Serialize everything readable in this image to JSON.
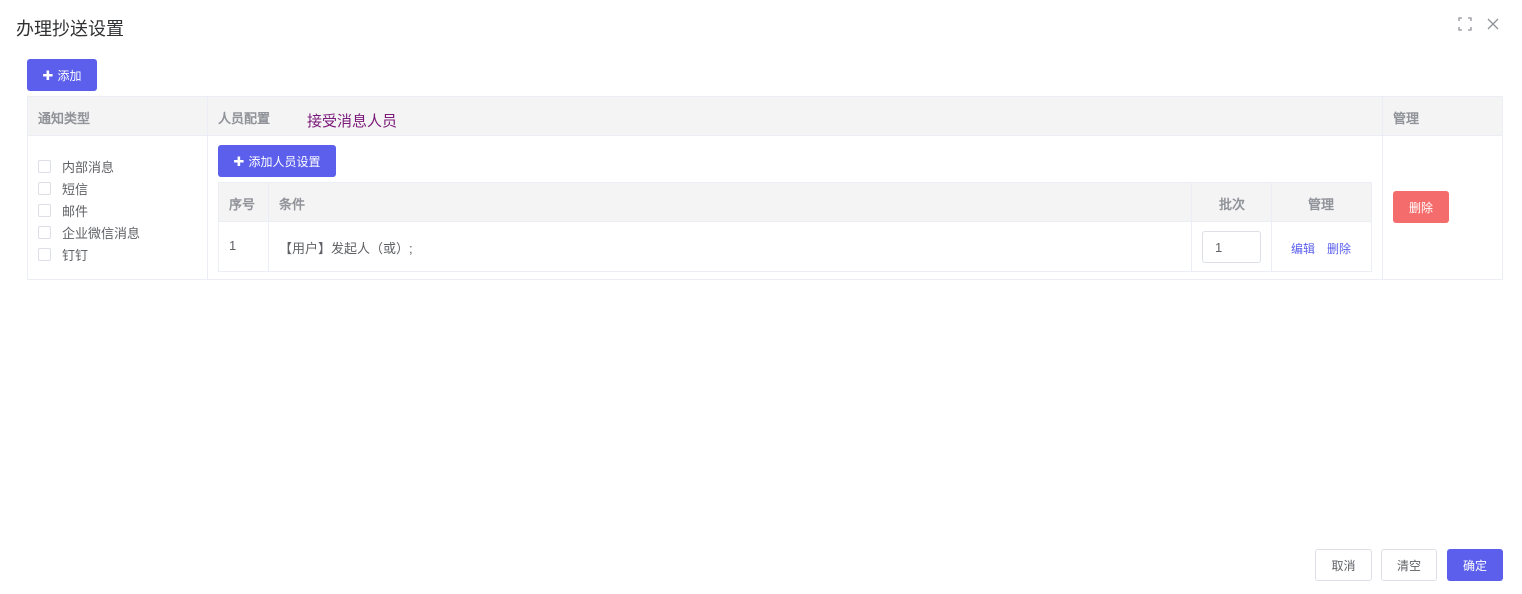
{
  "dialog": {
    "title": "办理抄送设置"
  },
  "toolbar": {
    "add_label": "添加",
    "plus_glyph": "✚"
  },
  "outer_table": {
    "headers": {
      "notify_type": "通知类型",
      "person_config": "人员配置",
      "manage": "管理"
    },
    "hint": "接受消息人员",
    "notify_types": [
      {
        "label": "内部消息",
        "checked": false
      },
      {
        "label": "短信",
        "checked": false
      },
      {
        "label": "邮件",
        "checked": false
      },
      {
        "label": "企业微信消息",
        "checked": false
      },
      {
        "label": "钉钉",
        "checked": false
      }
    ],
    "add_person_label": "添加人员设置",
    "delete_label": "删除"
  },
  "inner_table": {
    "headers": {
      "index": "序号",
      "condition": "条件",
      "batch": "批次",
      "manage": "管理"
    },
    "rows": [
      {
        "index": "1",
        "condition": "【用户】发起人（或）;",
        "batch": "1",
        "edit_label": "编辑",
        "delete_label": "删除"
      }
    ]
  },
  "footer": {
    "cancel_label": "取消",
    "clear_label": "清空",
    "confirm_label": "确定"
  },
  "colors": {
    "primary": "#5b5fec",
    "danger": "#f56c6c",
    "hint": "#7b1a7a",
    "header_bg": "#f4f4f4"
  },
  "icons": {
    "fullscreen": "fullscreen-icon",
    "close": "close-icon",
    "plus": "plus-icon",
    "checkbox": "checkbox-icon"
  }
}
